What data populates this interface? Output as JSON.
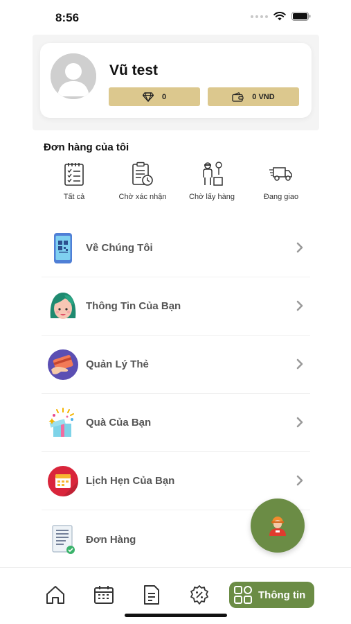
{
  "status_bar": {
    "time": "8:56",
    "icons": [
      "signal-dots",
      "wifi-icon",
      "battery-icon"
    ]
  },
  "profile": {
    "name": "Vũ test",
    "diamond_balance": "0",
    "wallet_balance": "0 VND"
  },
  "orders": {
    "title": "Đơn hàng của tôi",
    "tabs": [
      {
        "label": "Tất cả",
        "icon": "checklist-icon"
      },
      {
        "label": "Chờ xác nhận",
        "icon": "clipboard-clock-icon"
      },
      {
        "label": "Chờ lấy hàng",
        "icon": "delivery-man-icon"
      },
      {
        "label": "Đang giao",
        "icon": "delivery-truck-icon"
      }
    ]
  },
  "menu": [
    {
      "label": "Về Chúng Tôi",
      "icon": "phone-qr-icon"
    },
    {
      "label": "Thông Tin Của Bạn",
      "icon": "woman-avatar-icon"
    },
    {
      "label": "Quản Lý Thẻ",
      "icon": "credit-card-hand-icon"
    },
    {
      "label": "Quà Của Bạn",
      "icon": "gift-box-icon"
    },
    {
      "label": "Lịch Hẹn Của Bạn",
      "icon": "calendar-icon"
    },
    {
      "label": "Đơn Hàng",
      "icon": "order-document-icon"
    }
  ],
  "bottom_nav": {
    "items": [
      "home-icon",
      "calendar-icon",
      "document-icon",
      "discount-icon"
    ],
    "active_label": "Thông tin",
    "active_icon": "grid-icon"
  },
  "colors": {
    "accent_green": "#6b8c45",
    "balance_gold": "#dcc88e",
    "chevron_gray": "#9a9a9a"
  }
}
